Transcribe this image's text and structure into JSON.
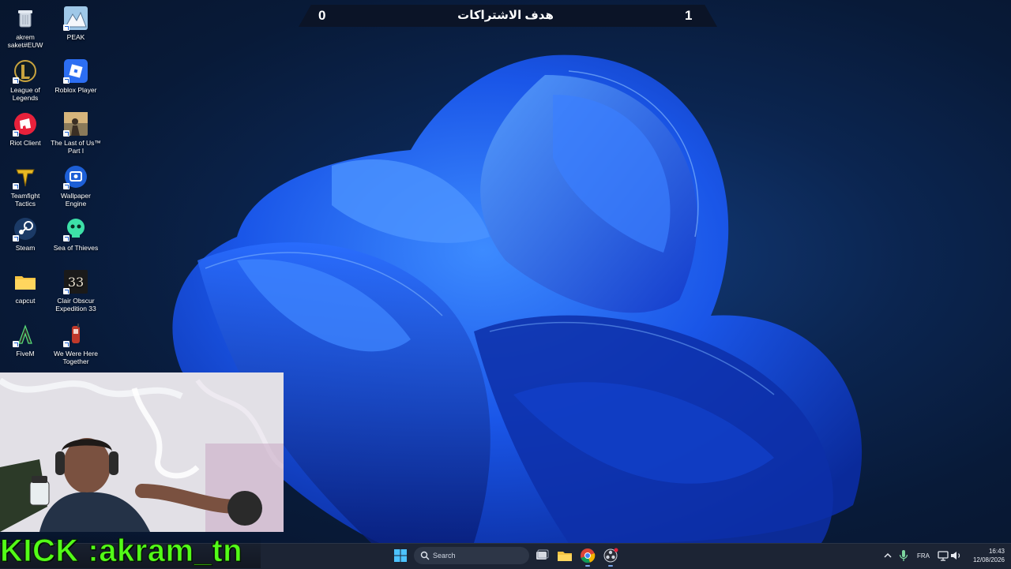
{
  "subscription_goal": {
    "title": "هدف الاشتراكات",
    "current": "0",
    "target": "1"
  },
  "desktop_icons": [
    {
      "label": "akrem saket#EUW",
      "icon": "recycle-bin-icon"
    },
    {
      "label": "PEAK",
      "icon": "peak-game-icon"
    },
    {
      "label": "League of Legends",
      "icon": "league-of-legends-icon"
    },
    {
      "label": "Roblox Player",
      "icon": "roblox-icon"
    },
    {
      "label": "Riot Client",
      "icon": "riot-client-icon"
    },
    {
      "label": "The Last of Us™ Part I",
      "icon": "last-of-us-icon"
    },
    {
      "label": "Teamfight Tactics",
      "icon": "teamfight-tactics-icon"
    },
    {
      "label": "Wallpaper Engine",
      "icon": "wallpaper-engine-icon"
    },
    {
      "label": "Steam",
      "icon": "steam-icon"
    },
    {
      "label": "Sea of Thieves",
      "icon": "sea-of-thieves-icon"
    },
    {
      "label": "capcut",
      "icon": "folder-icon"
    },
    {
      "label": "Clair Obscur Expedition 33",
      "icon": "clair-obscur-icon"
    },
    {
      "label": "FiveM",
      "icon": "fivem-icon"
    },
    {
      "label": "We Were Here Together",
      "icon": "we-were-here-icon"
    }
  ],
  "overlay": {
    "kick_label": "KICK :akram_tn"
  },
  "taskbar": {
    "search_placeholder": "Search",
    "apps": [
      "start-icon",
      "task-view-icon",
      "file-explorer-icon",
      "chrome-icon",
      "obs-icon"
    ],
    "language": "FRA",
    "time": "16:43",
    "date": "12/08/2026"
  },
  "colors": {
    "kick_green": "#53fc18",
    "taskbar_bg": "#1c2434",
    "wallpaper_blue": "#1f5cf0"
  }
}
